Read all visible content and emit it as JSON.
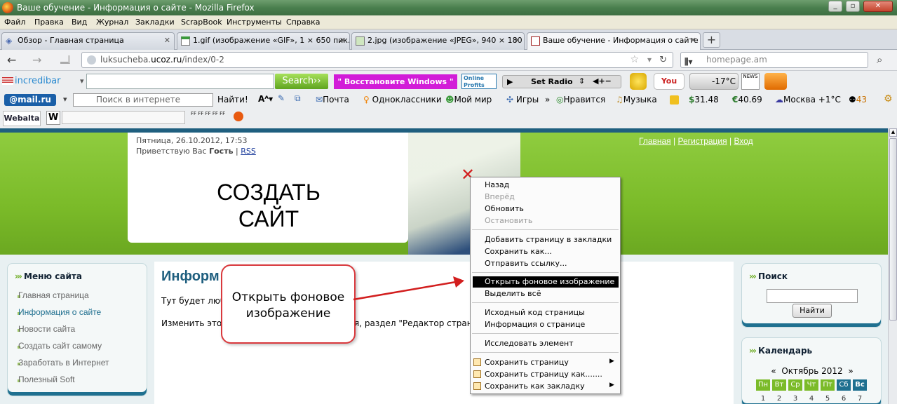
{
  "window": {
    "title": "Ваше обучение - Информация о сайте - Mozilla Firefox"
  },
  "menu": [
    "Файл",
    "Правка",
    "Вид",
    "Журнал",
    "Закладки",
    "ScrapBook",
    "Инструменты",
    "Справка"
  ],
  "tabs": [
    {
      "label": "Обзор - Главная страница"
    },
    {
      "label": "1.gif (изображение «GIF», 1 × 650 пик..."
    },
    {
      "label": "2.jpg (изображение «JPEG», 940 × 180 ..."
    },
    {
      "label": "Ваше обучение - Информация о сайте"
    }
  ],
  "nav": {
    "url_host": "luksucheba.",
    "url_domain": "ucoz.ru",
    "url_path": "/index/0-2",
    "search_placeholder": "homepage.am"
  },
  "toolbar1": {
    "incredibar": "incredibar",
    "search_btn": "Search››",
    "restore": "\" Восстановите Windows \"",
    "online_profits": "Online Profits",
    "radio": "Set Radio",
    "youtube": "You Tube",
    "temp": "-17°C",
    "news": "NEWS"
  },
  "toolbar2": {
    "mailru": "@mail.ru",
    "search_placeholder": "Поиск в интернете",
    "find": "Найти!",
    "links": [
      "Почта",
      "Одноклассники",
      "Мой мир",
      "Игры",
      "»",
      "Нравится",
      "Музыка"
    ],
    "dollar": "31.48",
    "euro": "40.69",
    "weather": "Москва +1°С",
    "count": "43"
  },
  "toolbar3": {
    "webalta": "Webalta"
  },
  "page": {
    "date": "Пятница, 26.10.2012, 17:53",
    "greeting_prefix": "Приветствую Вас ",
    "greeting_user": "Гость",
    "rss": "RSS",
    "logo_line1": "СОЗДАТЬ",
    "logo_line2": "САЙТ",
    "toplinks": [
      "Главная",
      "Регистрация",
      "Вход"
    ],
    "heading": "Информ",
    "para1": "Тут будет люба",
    "para2": "Изменить этот",
    "para2_tail": "я, раздел \"Редактор страниц\""
  },
  "sidebar": {
    "title": "Меню сайта",
    "items": [
      "Главная страница",
      "Информация о сайте",
      "Новости сайта",
      "Создать сайт самому",
      "Заработать в Интернет",
      "Полезный Soft"
    ]
  },
  "search_panel": {
    "title": "Поиск",
    "button": "Найти"
  },
  "calendar": {
    "title": "Календарь",
    "month": "Октябрь 2012",
    "prev": "«",
    "next": "»",
    "days": [
      "Пн",
      "Вт",
      "Ср",
      "Чт",
      "Пт",
      "Сб",
      "Вс"
    ],
    "dates": [
      "1",
      "2",
      "3",
      "4",
      "5",
      "6",
      "7"
    ]
  },
  "context_menu": {
    "back": "Назад",
    "forward": "Вперёд",
    "reload": "Обновить",
    "stop": "Остановить",
    "bookmark": "Добавить страницу в закладки",
    "save_as": "Сохранить как...",
    "send_link": "Отправить ссылку...",
    "view_bg": "Открыть фоновое изображение",
    "select_all": "Выделить всё",
    "view_source": "Исходный код страницы",
    "page_info": "Информация о странице",
    "inspect": "Исследовать элемент",
    "save_page": "Сохранить страницу",
    "save_page_as": "Сохранить страницу как.......",
    "save_as_bookmark": "Сохранить как закладку"
  },
  "callout": {
    "line1": "Открыть фоновое",
    "line2": "изображение"
  },
  "colors": {
    "accent_green": "#7bbb29",
    "menu_highlight": "#000000",
    "callout_border": "#d9393d",
    "link_blue": "#1a3a9a"
  }
}
